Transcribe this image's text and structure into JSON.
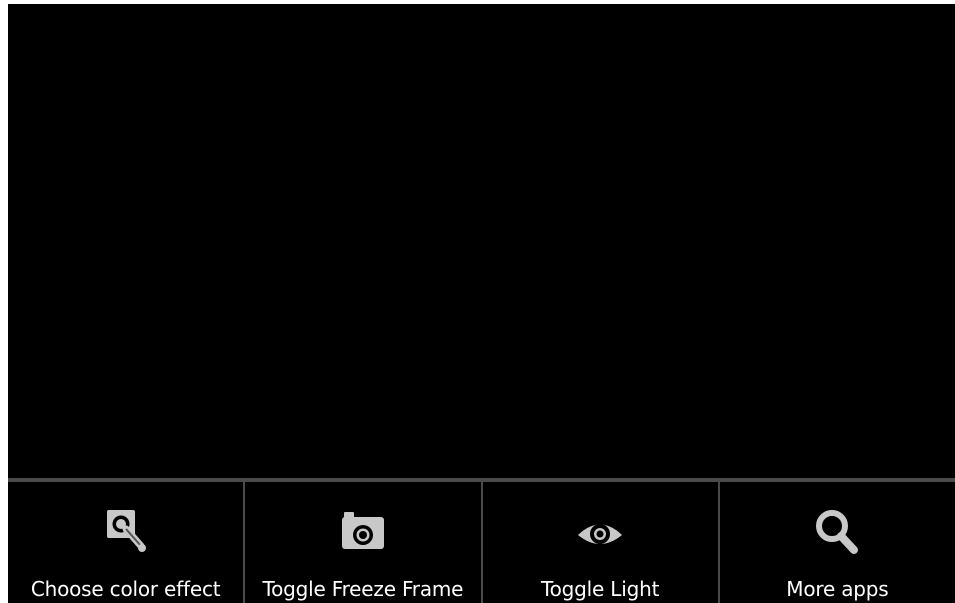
{
  "menu": {
    "items": [
      {
        "label": "Choose color effect",
        "icon": "wrench-magnify-icon"
      },
      {
        "label": "Toggle Freeze Frame",
        "icon": "camera-icon"
      },
      {
        "label": "Toggle Light",
        "icon": "eye-icon"
      },
      {
        "label": "More apps",
        "icon": "search-icon"
      }
    ]
  },
  "colors": {
    "background": "#000000",
    "divider": "#4a4a4a",
    "icon": "#c8c8c8",
    "text": "#ffffff"
  }
}
